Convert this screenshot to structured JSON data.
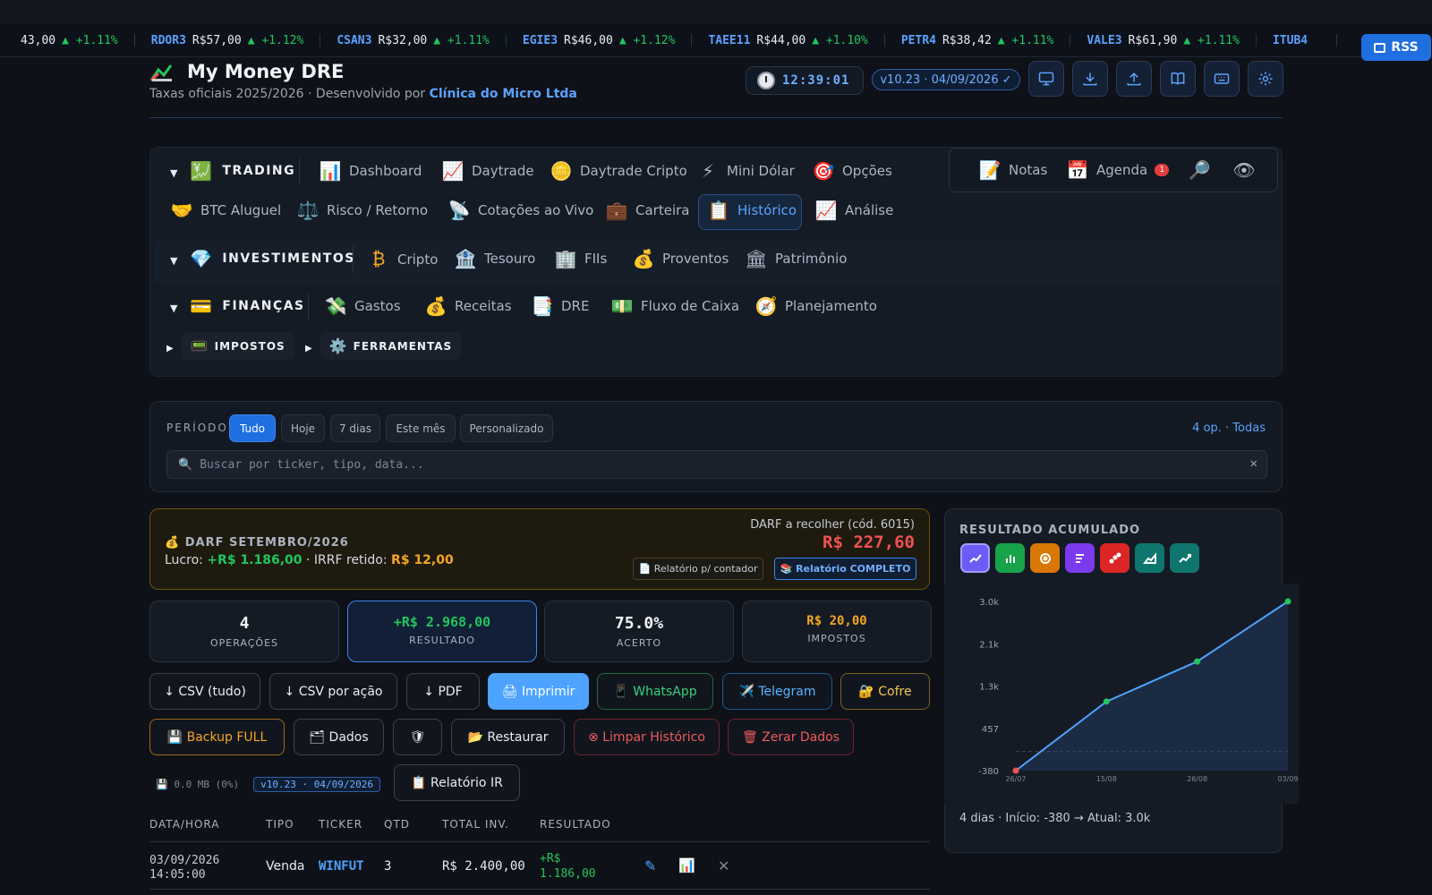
{
  "ticker": [
    {
      "symbol": "",
      "price": "43,00",
      "change": "▲ +1.11%"
    },
    {
      "symbol": "RDOR3",
      "price": "R$57,00",
      "change": "▲ +1.12%"
    },
    {
      "symbol": "CSAN3",
      "price": "R$32,00",
      "change": "▲ +1.11%"
    },
    {
      "symbol": "EGIE3",
      "price": "R$46,00",
      "change": "▲ +1.12%"
    },
    {
      "symbol": "TAEE11",
      "price": "R$44,00",
      "change": "▲ +1.10%"
    },
    {
      "symbol": "PETR4",
      "price": "R$38,42",
      "change": "▲ +1.11%"
    },
    {
      "symbol": "VALE3",
      "price": "R$61,90",
      "change": "▲ +1.11%"
    },
    {
      "symbol": "ITUB4",
      "price": "",
      "change": ""
    }
  ],
  "rss_label": "RSS",
  "header": {
    "title": "My Money DRE",
    "subtitle_prefix": "Taxas oficiais 2025/2026 · Desenvolvido por ",
    "subtitle_company": "Clínica do Micro Ltda",
    "clock": "12:39:01",
    "version": "v10.23 · 04/09/2026 ✓",
    "buttons": [
      "monitor-icon",
      "download-icon",
      "upload-icon",
      "book-icon",
      "keyboard-icon",
      "gear-icon"
    ]
  },
  "nav": {
    "trading_label": "TRADING",
    "trading_items": {
      "dashboard": "Dashboard",
      "daytrade": "Daytrade",
      "daytrade_cripto": "Daytrade Cripto",
      "mini_dolar": "Mini Dólar",
      "opcoes": "Opções",
      "btc_aluguel": "BTC Aluguel",
      "risco": "Risco / Retorno",
      "cotacoes": "Cotações ao Vivo",
      "carteira": "Carteira",
      "historico": "Histórico",
      "analise": "Análise"
    },
    "investimentos_label": "INVESTIMENTOS",
    "investimentos_items": {
      "cripto": "Cripto",
      "tesouro": "Tesouro",
      "fiis": "FIIs",
      "proventos": "Proventos",
      "patrimonio": "Patrimônio"
    },
    "financas_label": "FINANÇAS",
    "financas_items": {
      "gastos": "Gastos",
      "receitas": "Receitas",
      "dre": "DRE",
      "fluxo": "Fluxo de Caixa",
      "planejamento": "Planejamento"
    },
    "impostos_label": "IMPOSTOS",
    "ferramentas_label": "FERRAMENTAS",
    "tools": {
      "notas": "Notas",
      "agenda": "Agenda",
      "agenda_badge": "1"
    }
  },
  "filter": {
    "label": "PERÍODO",
    "options": [
      "Tudo",
      "Hoje",
      "7 dias",
      "Este mês",
      "Personalizado"
    ],
    "selected": "Tudo",
    "count": "4 op. · Todas",
    "search_placeholder": "Buscar por ticker, tipo, data..."
  },
  "darf": {
    "title": "💰 DARF SETEMBRO/2026",
    "lucro_label": "Lucro:",
    "lucro_value": "+R$ 1.186,00",
    "irrf_label": "IRRF retido:",
    "irrf_value": "R$ 12,00",
    "recolher_label": "DARF a recolher (cód. 6015)",
    "recolher_value": "R$ 227,60",
    "btn_contador": "📄 Relatório p/ contador",
    "btn_completo": "📚 Relatório COMPLETO"
  },
  "stats": [
    {
      "value": "4",
      "label": "OPERAÇÕES"
    },
    {
      "value": "+R$ 2.968,00",
      "label": "RESULTADO"
    },
    {
      "value": "75.0%",
      "label": "ACERTO"
    },
    {
      "value": "R$ 20,00",
      "label": "IMPOSTOS"
    }
  ],
  "actions": {
    "csv_all": "↓ CSV (tudo)",
    "csv_acao": "↓ CSV por ação",
    "pdf": "↓ PDF",
    "imprimir": "🖨 Imprimir",
    "whatsapp": "📱 WhatsApp",
    "telegram": "✈️ Telegram",
    "cofre": "🔐 Cofre",
    "backup": "💾 Backup FULL",
    "dados": "🗂 Dados",
    "shield": "🛡",
    "restaurar": "📂 Restaurar",
    "limpar": "⊗ Limpar Histórico",
    "zerar": "🗑 Zerar Dados",
    "relatorio_ir": "📋 Relatório IR"
  },
  "storage": {
    "size": "💾 0.0 MB (0%)",
    "version": "v10.23 · 04/09/2026"
  },
  "table": {
    "headers": [
      "DATA/HORA",
      "TIPO",
      "TICKER",
      "QTD",
      "TOTAL INV.",
      "RESULTADO"
    ],
    "rows": [
      {
        "date": "03/09/2026",
        "time": "14:05:00",
        "tipo": "Venda",
        "ticker": "WINFUT",
        "qtd": "3",
        "total": "R$ 2.400,00",
        "resultado_1": "+R$",
        "resultado_2": "1.186,00"
      }
    ]
  },
  "chart_panel": {
    "title": "RESULTADO ACUMULADO",
    "type_buttons": [
      {
        "icon": "line-chart-icon",
        "color": "#6a5cf5"
      },
      {
        "icon": "bar-chart-icon",
        "color": "#16a34a"
      },
      {
        "icon": "donut-chart-icon",
        "color": "#d97706"
      },
      {
        "icon": "horizontal-bar-icon",
        "color": "#7c3aed"
      },
      {
        "icon": "scatter-icon",
        "color": "#dc2626"
      },
      {
        "icon": "area-chart-icon",
        "color": "#0f766e"
      },
      {
        "icon": "trend-icon",
        "color": "#0f766e"
      }
    ],
    "footer": "4 dias · Início: -380 → Atual: 3.0k"
  },
  "chart_data": {
    "type": "area",
    "categories": [
      "26/07",
      "15/08",
      "26/08",
      "03/09"
    ],
    "values": [
      -380,
      1000,
      1800,
      3000
    ],
    "yticks": [
      "3.0k",
      "2.1k",
      "1.3k",
      "457",
      "-380"
    ],
    "ylim": [
      -380,
      3000
    ],
    "grid": false,
    "colors": {
      "line": "#4da3ff",
      "start": "#f05252",
      "points": "#22c55e"
    }
  }
}
